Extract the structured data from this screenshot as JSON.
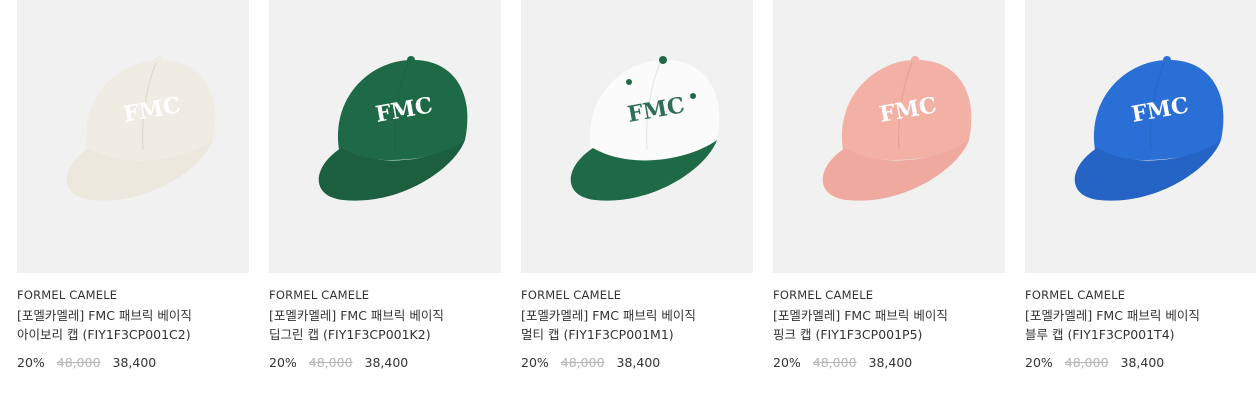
{
  "products": [
    {
      "brand": "FORMEL CAMELE",
      "name_line1": "[포멜카멜레] FMC 패브릭 베이직",
      "name_line2": "아이보리 캡 (FIY1F3CP001C2)",
      "discount": "20%",
      "original_price": "48,000",
      "sale_price": "38,400",
      "colors": {
        "crown": "#efece3",
        "visor": "#ece8de",
        "logo": "#ffffff",
        "button": "#efece3"
      }
    },
    {
      "brand": "FORMEL CAMELE",
      "name_line1": "[포멜카멜레] FMC 패브릭 베이직",
      "name_line2": "딥그린 캡 (FIY1F3CP001K2)",
      "discount": "20%",
      "original_price": "48,000",
      "sale_price": "38,400",
      "colors": {
        "crown": "#1f6a46",
        "visor": "#1b5f3f",
        "logo": "#ffffff",
        "button": "#1f6a46"
      }
    },
    {
      "brand": "FORMEL CAMELE",
      "name_line1": "[포멜카멜레] FMC 패브릭 베이직",
      "name_line2": "멀티 캡 (FIY1F3CP001M1)",
      "discount": "20%",
      "original_price": "48,000",
      "sale_price": "38,400",
      "colors": {
        "crown": "#fbfbfb",
        "visor": "#1f6a46",
        "logo": "#2f6f5a",
        "button": "#1f6a46"
      }
    },
    {
      "brand": "FORMEL CAMELE",
      "name_line1": "[포멜카멜레] FMC 패브릭 베이직",
      "name_line2": "핑크 캡 (FIY1F3CP001P5)",
      "discount": "20%",
      "original_price": "48,000",
      "sale_price": "38,400",
      "colors": {
        "crown": "#f3b1a6",
        "visor": "#f0a99e",
        "logo": "#ffffff",
        "button": "#f3b1a6"
      }
    },
    {
      "brand": "FORMEL CAMELE",
      "name_line1": "[포멜카멜레] FMC 패브릭 베이직",
      "name_line2": "블루 캡 (FIY1F3CP001T4)",
      "discount": "20%",
      "original_price": "48,000",
      "sale_price": "38,400",
      "colors": {
        "crown": "#2a6fd6",
        "visor": "#2563c4",
        "logo": "#ffffff",
        "button": "#2a6fd6"
      }
    }
  ]
}
